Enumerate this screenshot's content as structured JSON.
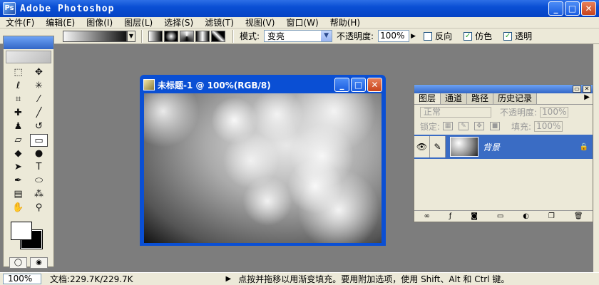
{
  "app": {
    "title": "Adobe Photoshop"
  },
  "menu": [
    "文件(F)",
    "编辑(E)",
    "图像(I)",
    "图层(L)",
    "选择(S)",
    "滤镜(T)",
    "视图(V)",
    "窗口(W)",
    "帮助(H)"
  ],
  "options": {
    "mode_label": "模式:",
    "mode_value": "变亮",
    "opacity_label": "不透明度:",
    "opacity_value": "100%",
    "reverse_label": "反向",
    "dither_label": "仿色",
    "transparency_label": "透明"
  },
  "document": {
    "title": "未标题-1 @ 100%(RGB/8)"
  },
  "layers_panel": {
    "tabs": [
      "图层",
      "通道",
      "路径",
      "历史记录"
    ],
    "blend_mode": "正常",
    "opacity_label": "不透明度:",
    "opacity_value": "100%",
    "lock_label": "锁定:",
    "fill_label": "填充:",
    "fill_value": "100%",
    "layer_name": "背景"
  },
  "status": {
    "zoom": "100%",
    "doc_size": "文档:229.7K/229.7K",
    "message": "点按并拖移以用渐变填充。要用附加选项，使用 Shift、Alt 和 Ctrl 键。"
  },
  "colors": {
    "titlebar": "#0a4fd4",
    "panel": "#ece9d8",
    "workspace": "#7d7d7d",
    "selected_layer": "#3a6cc4"
  }
}
